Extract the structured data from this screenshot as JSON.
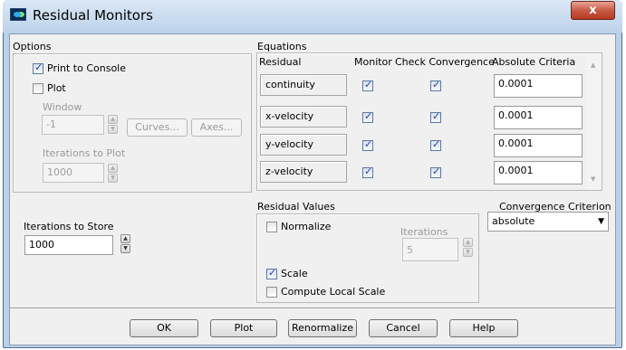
{
  "window": {
    "title": "Residual Monitors",
    "close_glyph": "x"
  },
  "options": {
    "heading": "Options",
    "print_to_console": {
      "label": "Print to Console",
      "checked": true
    },
    "plot": {
      "label": "Plot",
      "checked": false
    },
    "window_label": "Window",
    "window_value": "-1",
    "curves_button": "Curves...",
    "axes_button": "Axes...",
    "iterations_to_plot_label": "Iterations to Plot",
    "iterations_to_plot_value": "1000"
  },
  "iterations_to_store": {
    "label": "Iterations to Store",
    "value": "1000"
  },
  "equations": {
    "heading": "Equations",
    "columns": [
      "Residual",
      "Monitor",
      "Check Convergence",
      "Absolute Criteria"
    ],
    "rows": [
      {
        "residual": "continuity",
        "monitor": true,
        "check_convergence": true,
        "absolute_criteria": "0.0001"
      },
      {
        "residual": "x-velocity",
        "monitor": true,
        "check_convergence": true,
        "absolute_criteria": "0.0001"
      },
      {
        "residual": "y-velocity",
        "monitor": true,
        "check_convergence": true,
        "absolute_criteria": "0.0001"
      },
      {
        "residual": "z-velocity",
        "monitor": true,
        "check_convergence": true,
        "absolute_criteria": "0.0001"
      }
    ]
  },
  "residual_values": {
    "heading": "Residual Values",
    "normalize": {
      "label": "Normalize",
      "checked": false
    },
    "iterations_label": "Iterations",
    "iterations_value": "5",
    "scale": {
      "label": "Scale",
      "checked": true
    },
    "compute_local_scale": {
      "label": "Compute Local Scale",
      "checked": false
    }
  },
  "convergence_criterion": {
    "label": "Convergence Criterion",
    "selected": "absolute"
  },
  "buttons": {
    "ok": "OK",
    "plot": "Plot",
    "renormalize": "Renormalize",
    "cancel": "Cancel",
    "help": "Help"
  },
  "icons": {
    "app": "fluent-app-icon",
    "close": "close-icon",
    "dropdown": "chevron-down-icon",
    "spin_up": "spin-up-icon",
    "spin_down": "spin-down-icon"
  }
}
